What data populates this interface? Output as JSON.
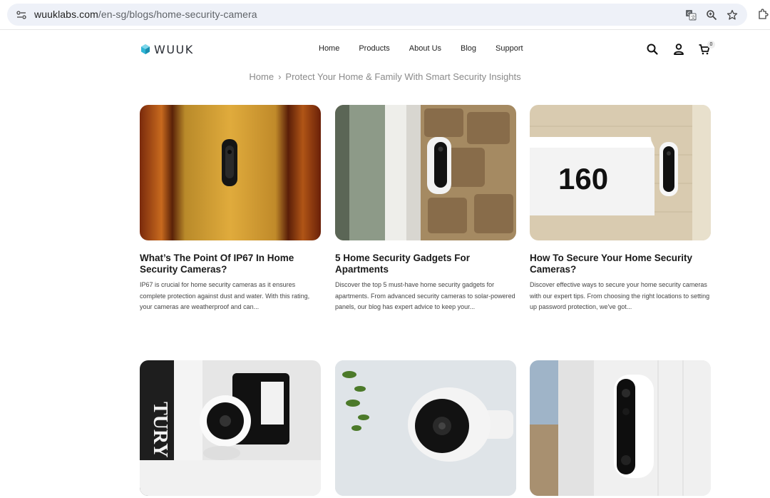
{
  "browser": {
    "url_domain": "wuuklabs.com",
    "url_path": "/en-sg/blogs/home-security-camera",
    "icons": [
      "site-info-icon",
      "translate-icon",
      "zoom-icon",
      "bookmark-star-icon",
      "extensions-icon"
    ]
  },
  "header": {
    "logo_text": "WUUK",
    "nav": [
      "Home",
      "Products",
      "About Us",
      "Blog",
      "Support"
    ],
    "icons": [
      "search-icon",
      "account-icon",
      "cart-icon"
    ],
    "cart_count": "0"
  },
  "breadcrumb": {
    "home": "Home",
    "separator": "›",
    "current": "Protect Your Home & Family With Smart Security Insights"
  },
  "posts": [
    {
      "title": "What’s The Point Of IP67 In Home Security Cameras?",
      "excerpt": "IP67 is crucial for home security cameras as it ensures complete protection against dust and water. With this rating, your cameras are weatherproof and can..."
    },
    {
      "title": "5 Home Security Gadgets For Apartments",
      "excerpt": "Discover the top 5 must-have home security gadgets for apartments. From advanced security cameras to solar-powered panels, our blog has expert advice to keep your..."
    },
    {
      "title": "How To Secure Your Home Security Cameras?",
      "excerpt": "Discover effective ways to secure your home security cameras with our expert tips. From choosing the right locations to setting up password protection, we've got...",
      "image_text": "160"
    },
    {
      "title": "",
      "excerpt": "",
      "image_text": "TURY"
    },
    {
      "title": "",
      "excerpt": ""
    },
    {
      "title": "",
      "excerpt": ""
    }
  ],
  "colors": {
    "accent": "#1aa6c8",
    "text": "#1a1a1a",
    "muted": "#8a8a8a",
    "url_bar": "#eef1f8"
  }
}
